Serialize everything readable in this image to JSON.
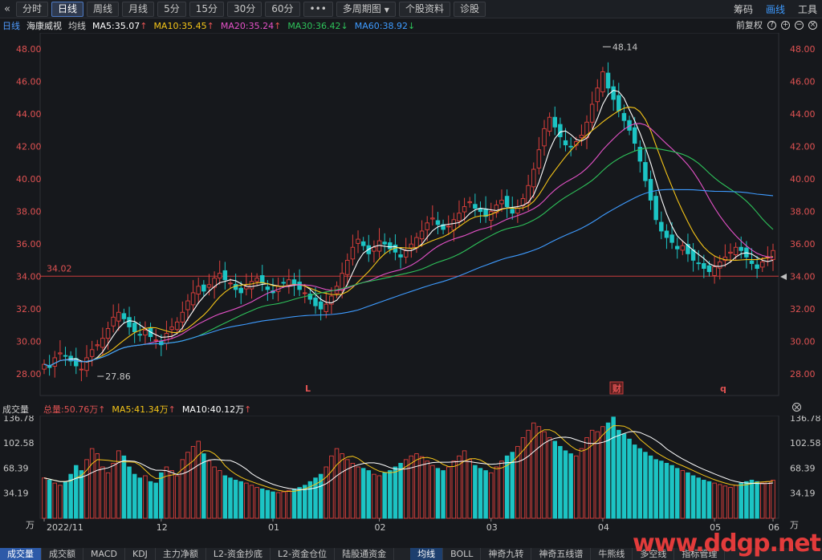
{
  "toolbar": {
    "collapse_icon": "double-chevron-left-icon",
    "buttons": [
      "分时",
      "日线",
      "周线",
      "月线",
      "5分",
      "15分",
      "30分",
      "60分",
      "•••",
      "多周期图",
      "个股资料",
      "诊股"
    ],
    "active": "日线",
    "right": [
      "筹码",
      "画线",
      "工具"
    ]
  },
  "legend": {
    "period": "日线",
    "stock": "海康威视",
    "avg_label": "均线",
    "ma5": "MA5:35.07",
    "ma10": "MA10:35.45",
    "ma20": "MA20:35.24",
    "ma30": "MA30:36.42",
    "ma60": "MA60:38.92",
    "fq": "前复权",
    "colors": {
      "ma5": "#ffffff",
      "ma10": "#f5c518",
      "ma20": "#e552c8",
      "ma30": "#2ec25a",
      "ma60": "#3e9bff"
    }
  },
  "price_chart": {
    "y_ticks": [
      "48.00",
      "46.00",
      "44.00",
      "42.00",
      "40.00",
      "38.00",
      "36.00",
      "34.00",
      "32.00",
      "30.00",
      "28.00"
    ],
    "ref_line": "34.02",
    "high_label": "48.14",
    "low_label": "27.86",
    "markers": [
      "L",
      "财",
      "q"
    ]
  },
  "volume": {
    "title": "成交量",
    "total": "总量:50.76万",
    "ma5": "MA5:41.34万",
    "ma10": "MA10:40.12万",
    "y_ticks": [
      "136.78",
      "102.58",
      "68.39",
      "34.19"
    ],
    "unit": "万",
    "dates": [
      "2022/11",
      "12",
      "01",
      "02",
      "03",
      "04",
      "05",
      "06"
    ]
  },
  "bottom_tabs": [
    "成交量",
    "成交额",
    "MACD",
    "KDJ",
    "主力净额",
    "L2-资金抄底",
    "L2-资金仓位",
    "陆股通资金",
    "均线",
    "BOLL",
    "神奇九转",
    "神奇五线谱",
    "牛熊线",
    "多空线",
    "指标管理"
  ],
  "watermark": "www.ddgp.net",
  "chart_data": {
    "type": "candlestick",
    "price_ylim": [
      27.5,
      48.5
    ],
    "volume_ylim": [
      0,
      140
    ],
    "ma_last": {
      "MA5": 35.07,
      "MA10": 35.45,
      "MA20": 35.24,
      "MA30": 36.42,
      "MA60": 38.92
    },
    "closes": [
      28.6,
      28.4,
      29.0,
      29.3,
      29.1,
      28.8,
      28.5,
      28.3,
      29.0,
      29.5,
      29.8,
      30.2,
      30.8,
      31.5,
      31.8,
      31.4,
      30.9,
      30.6,
      30.4,
      30.7,
      30.3,
      30.1,
      29.8,
      30.5,
      30.9,
      31.2,
      31.8,
      32.5,
      33.0,
      33.4,
      33.1,
      33.5,
      33.9,
      34.2,
      33.8,
      33.6,
      33.2,
      33.0,
      33.4,
      33.7,
      33.9,
      33.6,
      33.2,
      33.0,
      33.4,
      33.6,
      33.8,
      33.5,
      33.2,
      33.0,
      32.6,
      32.2,
      32.0,
      32.3,
      32.8,
      33.4,
      34.2,
      35.0,
      35.8,
      36.3,
      35.9,
      35.4,
      35.8,
      36.2,
      36.0,
      35.7,
      35.5,
      35.2,
      35.6,
      36.0,
      36.4,
      36.8,
      37.3,
      37.6,
      37.2,
      36.9,
      37.1,
      37.5,
      37.9,
      38.3,
      38.6,
      38.2,
      38.0,
      37.7,
      38.0,
      38.4,
      38.7,
      38.3,
      37.9,
      38.2,
      38.8,
      39.6,
      40.6,
      41.8,
      43.1,
      43.8,
      43.2,
      42.6,
      42.1,
      42.0,
      42.3,
      42.7,
      43.5,
      44.6,
      45.6,
      46.6,
      45.6,
      44.9,
      44.2,
      43.6,
      43.0,
      42.2,
      41.1,
      39.9,
      38.7,
      37.5,
      36.8,
      36.4,
      36.1,
      35.7,
      35.9,
      35.4,
      35.0,
      34.8,
      34.5,
      34.3,
      34.6,
      34.9,
      35.2,
      35.5,
      35.8,
      35.6,
      35.2,
      34.8,
      34.5,
      34.9,
      35.2,
      35.6
    ],
    "volumes": [
      55,
      52,
      48,
      45,
      50,
      60,
      72,
      65,
      80,
      95,
      88,
      70,
      62,
      75,
      92,
      85,
      70,
      60,
      55,
      58,
      50,
      48,
      62,
      70,
      65,
      58,
      80,
      90,
      98,
      105,
      88,
      78,
      70,
      65,
      58,
      55,
      52,
      50,
      48,
      45,
      42,
      40,
      38,
      36,
      35,
      36,
      38,
      40,
      42,
      45,
      50,
      55,
      60,
      70,
      85,
      95,
      88,
      80,
      75,
      70,
      68,
      65,
      60,
      58,
      62,
      65,
      70,
      75,
      80,
      85,
      88,
      84,
      78,
      72,
      68,
      65,
      70,
      78,
      85,
      92,
      80,
      72,
      68,
      65,
      62,
      70,
      78,
      85,
      90,
      98,
      110,
      120,
      130,
      125,
      118,
      110,
      105,
      98,
      92,
      88,
      85,
      95,
      110,
      120,
      118,
      125,
      130,
      138,
      120,
      115,
      108,
      100,
      95,
      90,
      85,
      80,
      78,
      75,
      72,
      68,
      65,
      62,
      58,
      55,
      52,
      50,
      48,
      46,
      44,
      42,
      45,
      48,
      50,
      52,
      50,
      48,
      50,
      52
    ]
  }
}
